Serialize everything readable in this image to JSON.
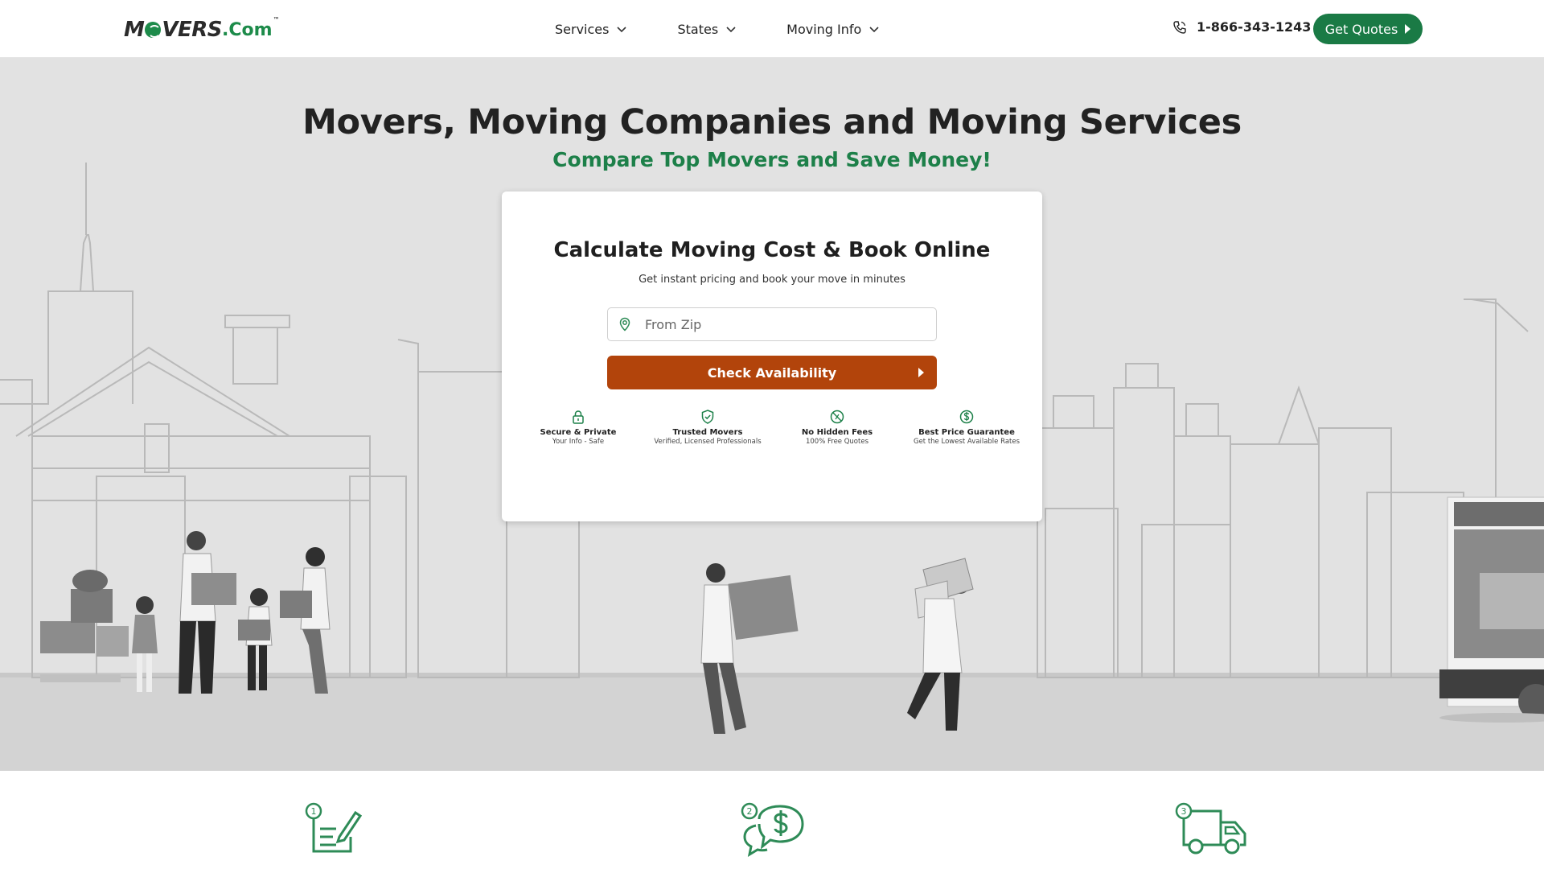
{
  "header": {
    "logo": {
      "word_left": "M",
      "word_right": "VERS",
      "com": ".Com",
      "tm": "™"
    },
    "nav": [
      {
        "label": "Services"
      },
      {
        "label": "States"
      },
      {
        "label": "Moving Info"
      }
    ],
    "phone": "1-866-343-1243",
    "cta_label": "Get Quotes"
  },
  "hero": {
    "title": "Movers, Moving Companies and Moving Services",
    "subtitle": "Compare Top Movers and Save Money!"
  },
  "card": {
    "title": "Calculate Moving Cost & Book Online",
    "subtitle": "Get instant pricing and book your move in minutes",
    "zip_placeholder": "From Zip",
    "button_label": "Check Availability",
    "badges": [
      {
        "icon": "lock-icon",
        "title": "Secure & Private",
        "sub": "Your Info - Safe"
      },
      {
        "icon": "shield-check-icon",
        "title": "Trusted Movers",
        "sub": "Verified, Licensed Professionals"
      },
      {
        "icon": "no-fee-icon",
        "title": "No Hidden Fees",
        "sub": "100% Free Quotes"
      },
      {
        "icon": "dollar-circle-icon",
        "title": "Best Price Guarantee",
        "sub": "Get the Lowest Available Rates"
      }
    ]
  },
  "steps": [
    {
      "number": "1",
      "icon": "form-edit-icon"
    },
    {
      "number": "2",
      "icon": "chat-dollar-icon"
    },
    {
      "number": "3",
      "icon": "moving-truck-icon"
    }
  ],
  "colors": {
    "brand_green": "#1a7a45",
    "accent_orange": "#b2440b",
    "hero_bg": "#e2e2e2"
  }
}
